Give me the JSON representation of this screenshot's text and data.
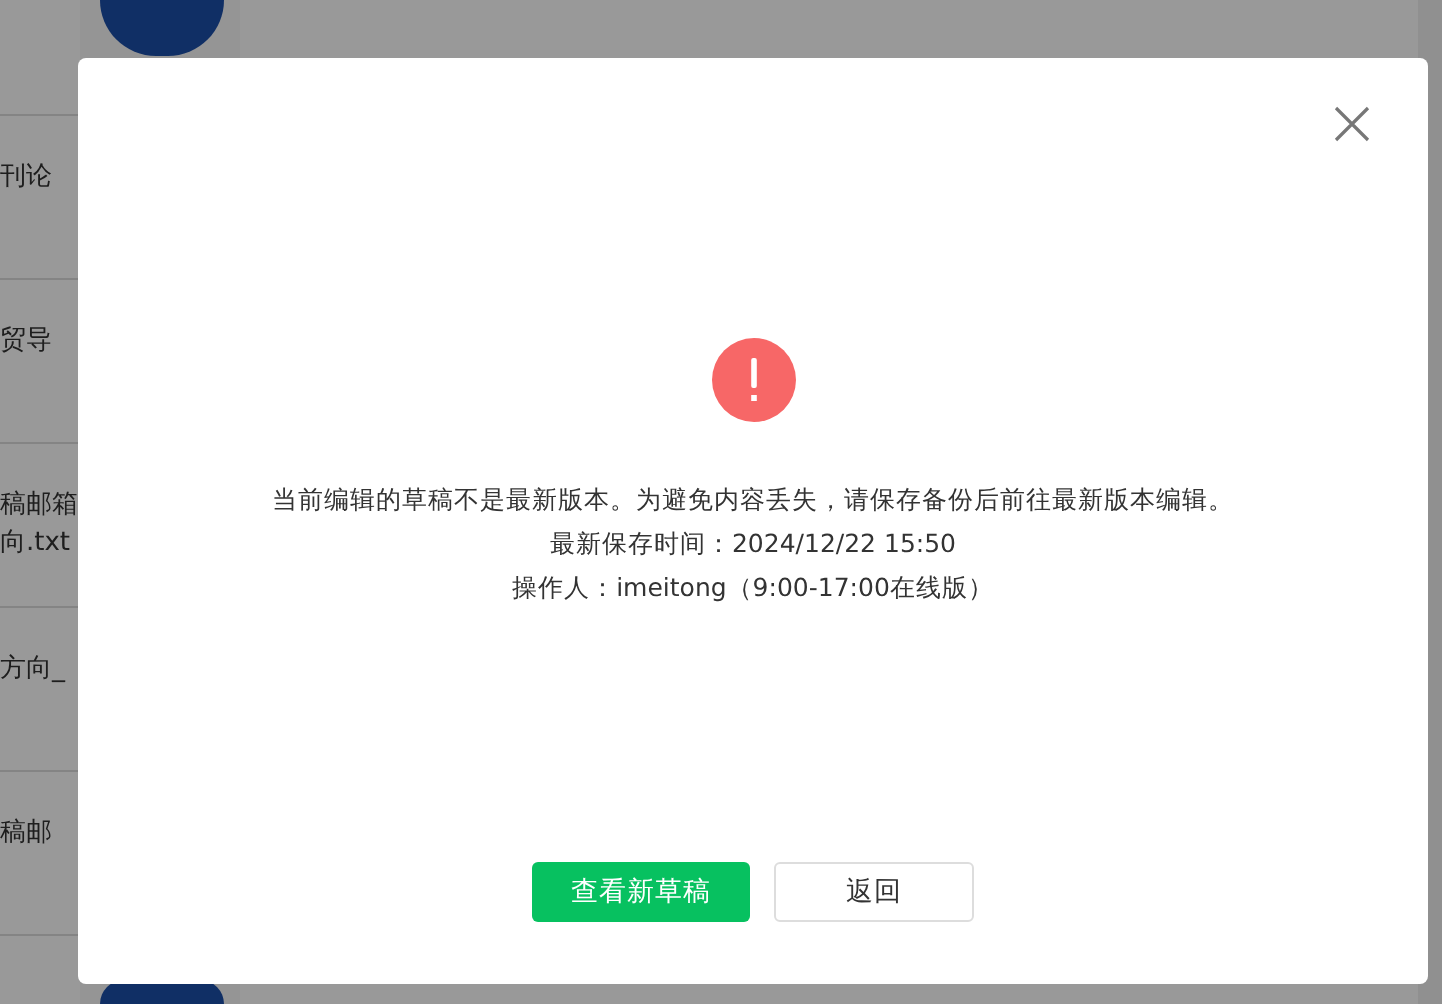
{
  "background": {
    "list_items": [
      {
        "lines": [
          "刊论"
        ]
      },
      {
        "lines": [
          "贸导"
        ]
      },
      {
        "lines": [
          "稿邮箱",
          "向.txt"
        ]
      },
      {
        "lines": [
          "方向_"
        ]
      },
      {
        "lines": [
          "稿邮"
        ]
      }
    ]
  },
  "dialog": {
    "message_lines": [
      "当前编辑的草稿不是最新版本。为避免内容丢失，请保存备份后前往最新版本编辑。",
      "最新保存时间：2024/12/22 15:50",
      "操作人：imeitong（9:00-17:00在线版）"
    ],
    "buttons": [
      {
        "label": "查看新草稿",
        "kind": "primary"
      },
      {
        "label": "返回",
        "kind": "default"
      }
    ]
  }
}
